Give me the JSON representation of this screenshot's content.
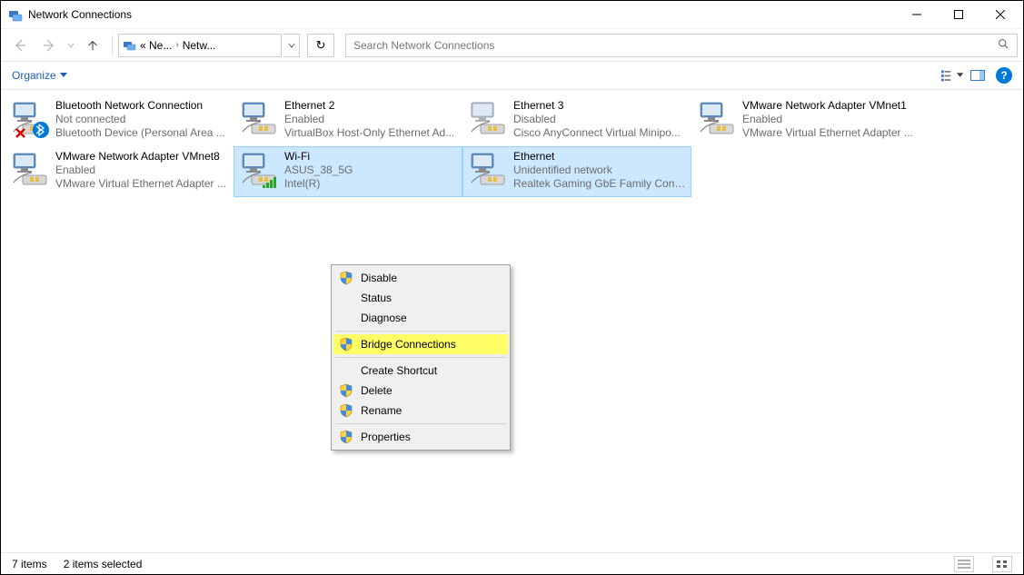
{
  "window": {
    "title": "Network Connections"
  },
  "address": {
    "crumb1": "« Ne...",
    "crumb2": "Netw..."
  },
  "search": {
    "placeholder": "Search Network Connections"
  },
  "toolbar": {
    "organize": "Organize"
  },
  "connections": [
    {
      "name": "Bluetooth Network Connection",
      "status": "Not connected",
      "device": "Bluetooth Device (Personal Area ...",
      "selected": false,
      "overlay": "bt-x"
    },
    {
      "name": "Ethernet 2",
      "status": "Enabled",
      "device": "VirtualBox Host-Only Ethernet Ad...",
      "selected": false,
      "overlay": ""
    },
    {
      "name": "Ethernet 3",
      "status": "Disabled",
      "device": "Cisco AnyConnect Virtual Minipo...",
      "selected": false,
      "overlay": "grey"
    },
    {
      "name": "VMware Network Adapter VMnet1",
      "status": "Enabled",
      "device": "VMware Virtual Ethernet Adapter ...",
      "selected": false,
      "overlay": ""
    },
    {
      "name": "VMware Network Adapter VMnet8",
      "status": "Enabled",
      "device": "VMware Virtual Ethernet Adapter ...",
      "selected": false,
      "overlay": ""
    },
    {
      "name": "Wi-Fi",
      "status": "ASUS_38_5G",
      "device": "Intel(R)",
      "selected": true,
      "overlay": "wifi"
    },
    {
      "name": "Ethernet",
      "status": "Unidentified network",
      "device": "Realtek Gaming GbE Family Contr...",
      "selected": true,
      "overlay": ""
    }
  ],
  "context_menu": {
    "items": [
      {
        "label": "Disable",
        "shield": true,
        "hl": false
      },
      {
        "label": "Status",
        "shield": false,
        "hl": false
      },
      {
        "label": "Diagnose",
        "shield": false,
        "hl": false
      },
      {
        "sep": true
      },
      {
        "label": "Bridge Connections",
        "shield": true,
        "hl": true
      },
      {
        "sep": true
      },
      {
        "label": "Create Shortcut",
        "shield": false,
        "hl": false
      },
      {
        "label": "Delete",
        "shield": true,
        "hl": false
      },
      {
        "label": "Rename",
        "shield": true,
        "hl": false
      },
      {
        "sep": true
      },
      {
        "label": "Properties",
        "shield": true,
        "hl": false
      }
    ]
  },
  "statusbar": {
    "total": "7 items",
    "selected": "2 items selected"
  }
}
